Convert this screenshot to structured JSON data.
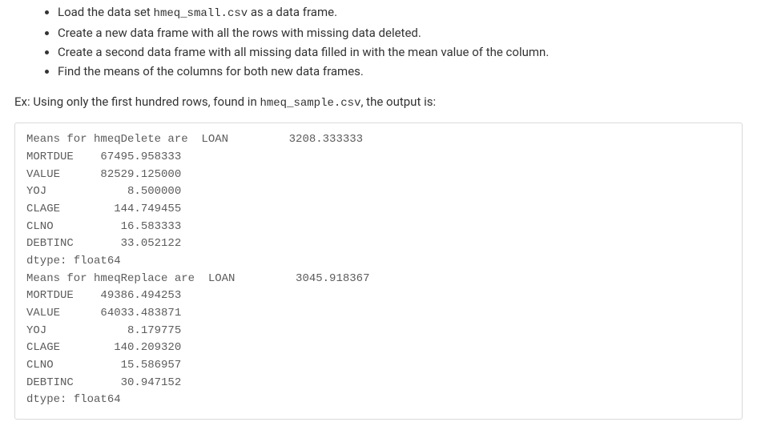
{
  "bullets": [
    {
      "prefix": "Load the data set ",
      "code": "hmeq_small.csv",
      "suffix": " as a data frame."
    },
    {
      "prefix": "Create a new data frame with all the rows with missing data deleted.",
      "code": "",
      "suffix": ""
    },
    {
      "prefix": "Create a second data frame with all missing data filled in with the mean value of the column.",
      "code": "",
      "suffix": ""
    },
    {
      "prefix": "Find the means of the columns for both new data frames.",
      "code": "",
      "suffix": ""
    }
  ],
  "example_line": {
    "prefix": "Ex: Using only the first hundred rows, found in ",
    "code": "hmeq_sample.csv",
    "suffix": ", the output is:"
  },
  "output_text": "Means for hmeqDelete are  LOAN         3208.333333\nMORTDUE    67495.958333\nVALUE      82529.125000\nYOJ            8.500000\nCLAGE        144.749455\nCLNO          16.583333\nDEBTINC       33.052122\ndtype: float64\nMeans for hmeqReplace are  LOAN         3045.918367\nMORTDUE    49386.494253\nVALUE      64033.483871\nYOJ            8.179775\nCLAGE        140.209320\nCLNO          15.586957\nDEBTINC       30.947152\ndtype: float64"
}
